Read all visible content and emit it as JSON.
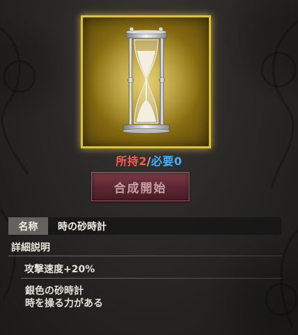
{
  "item": {
    "icon": "hourglass-icon",
    "frame_color": "#d9c24c",
    "owned_label": "所持",
    "owned_count": "2",
    "separator": "/",
    "required_label": "必要",
    "required_count": "0",
    "owned_color": "#ff5a4e",
    "required_color": "#3fb0ff"
  },
  "craft_button": {
    "label": "合成開始"
  },
  "info": {
    "name_label": "名称",
    "name_value": "時の砂時計",
    "detail_heading": "詳細説明",
    "effect": "攻撃速度+20%",
    "description_lines": [
      "銀色の砂時計",
      "時を操る力がある"
    ]
  }
}
